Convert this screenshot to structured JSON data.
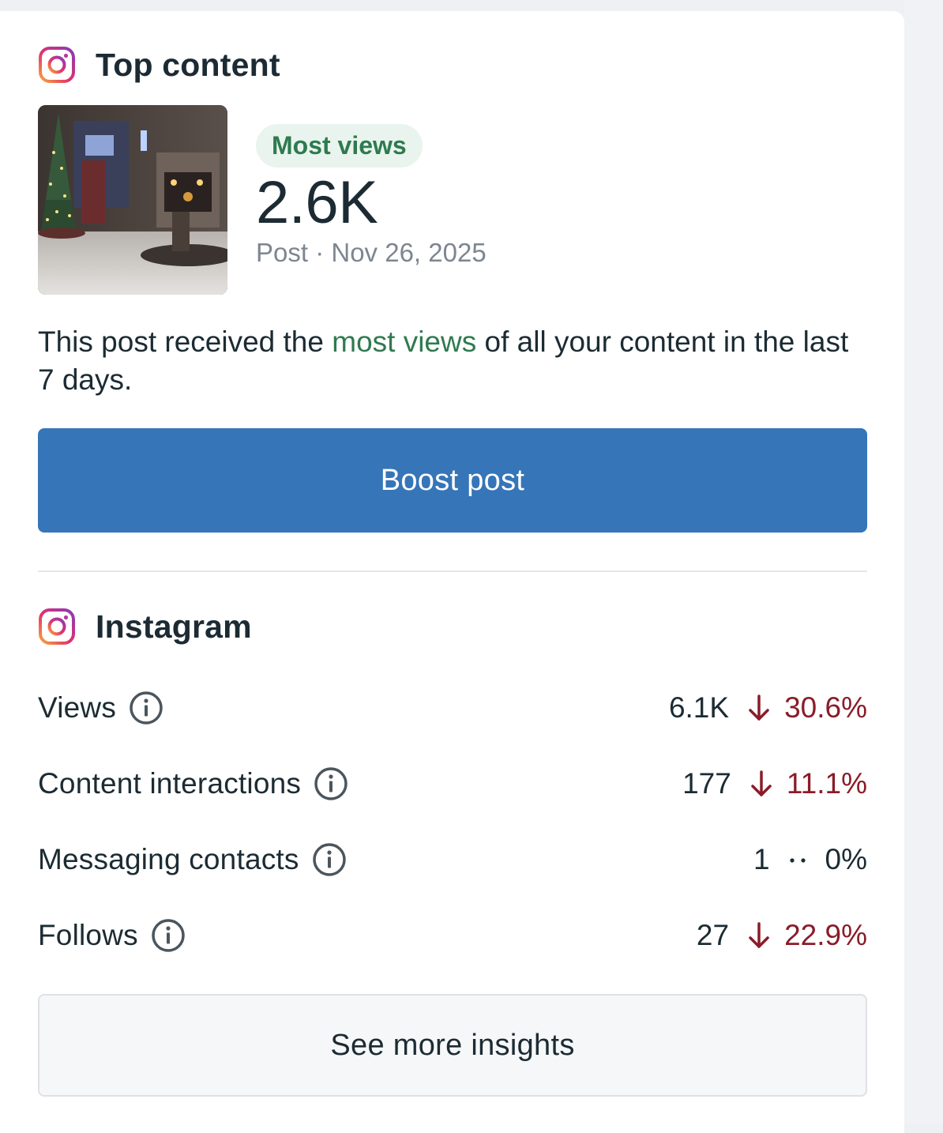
{
  "top_content": {
    "title": "Top content",
    "icon": "instagram-icon",
    "post": {
      "badge": "Most views",
      "value": "2.6K",
      "date": "Post · Nov 26, 2025",
      "thumbnail": "christmas-tree-stone-fireplace-interior"
    },
    "description": {
      "before": "This post received the ",
      "highlight": "most views",
      "after": " of all your content in the last 7 days."
    },
    "boost_label": "Boost post"
  },
  "instagram": {
    "title": "Instagram",
    "icon": "instagram-icon",
    "metrics": [
      {
        "label": "Views",
        "value": "6.1K",
        "trend": "down",
        "change": "30.6%"
      },
      {
        "label": "Content interactions",
        "value": "177",
        "trend": "down",
        "change": "11.1%"
      },
      {
        "label": "Messaging contacts",
        "value": "1",
        "trend": "neutral",
        "change": "0%"
      },
      {
        "label": "Follows",
        "value": "27",
        "trend": "down",
        "change": "22.9%"
      }
    ],
    "insights_label": "See more insights"
  },
  "colors": {
    "accent_green": "#2f7a4f",
    "badge_bg": "#e9f4ee",
    "button_blue": "#3675b8",
    "negative_red": "#8a1c28",
    "text_dark": "#1c2b33",
    "text_muted": "#7d8690"
  }
}
